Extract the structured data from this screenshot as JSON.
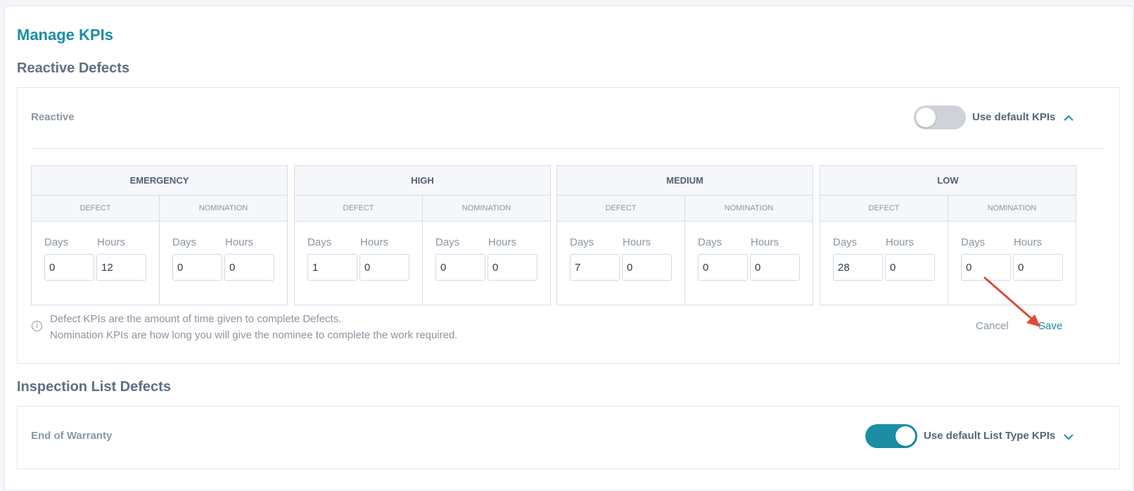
{
  "page": {
    "title": "Manage KPIs"
  },
  "reactive_section": {
    "title": "Reactive Defects",
    "panel_label": "Reactive",
    "toggle": {
      "label": "Use default KPIs",
      "state": "off"
    },
    "groups": [
      {
        "name": "EMERGENCY",
        "defect": {
          "header": "DEFECT",
          "days_label": "Days",
          "hours_label": "Hours",
          "days": "0",
          "hours": "12"
        },
        "nomination": {
          "header": "NOMINATION",
          "days_label": "Days",
          "hours_label": "Hours",
          "days": "0",
          "hours": "0"
        }
      },
      {
        "name": "HIGH",
        "defect": {
          "header": "DEFECT",
          "days_label": "Days",
          "hours_label": "Hours",
          "days": "1",
          "hours": "0"
        },
        "nomination": {
          "header": "NOMINATION",
          "days_label": "Days",
          "hours_label": "Hours",
          "days": "0",
          "hours": "0"
        }
      },
      {
        "name": "MEDIUM",
        "defect": {
          "header": "DEFECT",
          "days_label": "Days",
          "hours_label": "Hours",
          "days": "7",
          "hours": "0"
        },
        "nomination": {
          "header": "NOMINATION",
          "days_label": "Days",
          "hours_label": "Hours",
          "days": "0",
          "hours": "0"
        }
      },
      {
        "name": "LOW",
        "defect": {
          "header": "DEFECT",
          "days_label": "Days",
          "hours_label": "Hours",
          "days": "28",
          "hours": "0"
        },
        "nomination": {
          "header": "NOMINATION",
          "days_label": "Days",
          "hours_label": "Hours",
          "days": "0",
          "hours": "0"
        }
      }
    ],
    "info_lines": [
      "Defect KPIs are the amount of time given to complete Defects.",
      "Nomination KPIs are how long you will give the nominee to complete the work required."
    ],
    "cancel_label": "Cancel",
    "save_label": "Save"
  },
  "inspection_section": {
    "title": "Inspection List Defects",
    "panel_label": "End of Warranty",
    "toggle": {
      "label": "Use default List Type KPIs",
      "state": "on"
    }
  },
  "colors": {
    "accent": "#1b8ea6",
    "annotation_arrow": "#e04b36",
    "toggle_off": "#cfd3d8"
  },
  "icons": {
    "expand_up": "chevron-up-icon",
    "expand_down": "chevron-down-icon",
    "info": "info-icon"
  }
}
